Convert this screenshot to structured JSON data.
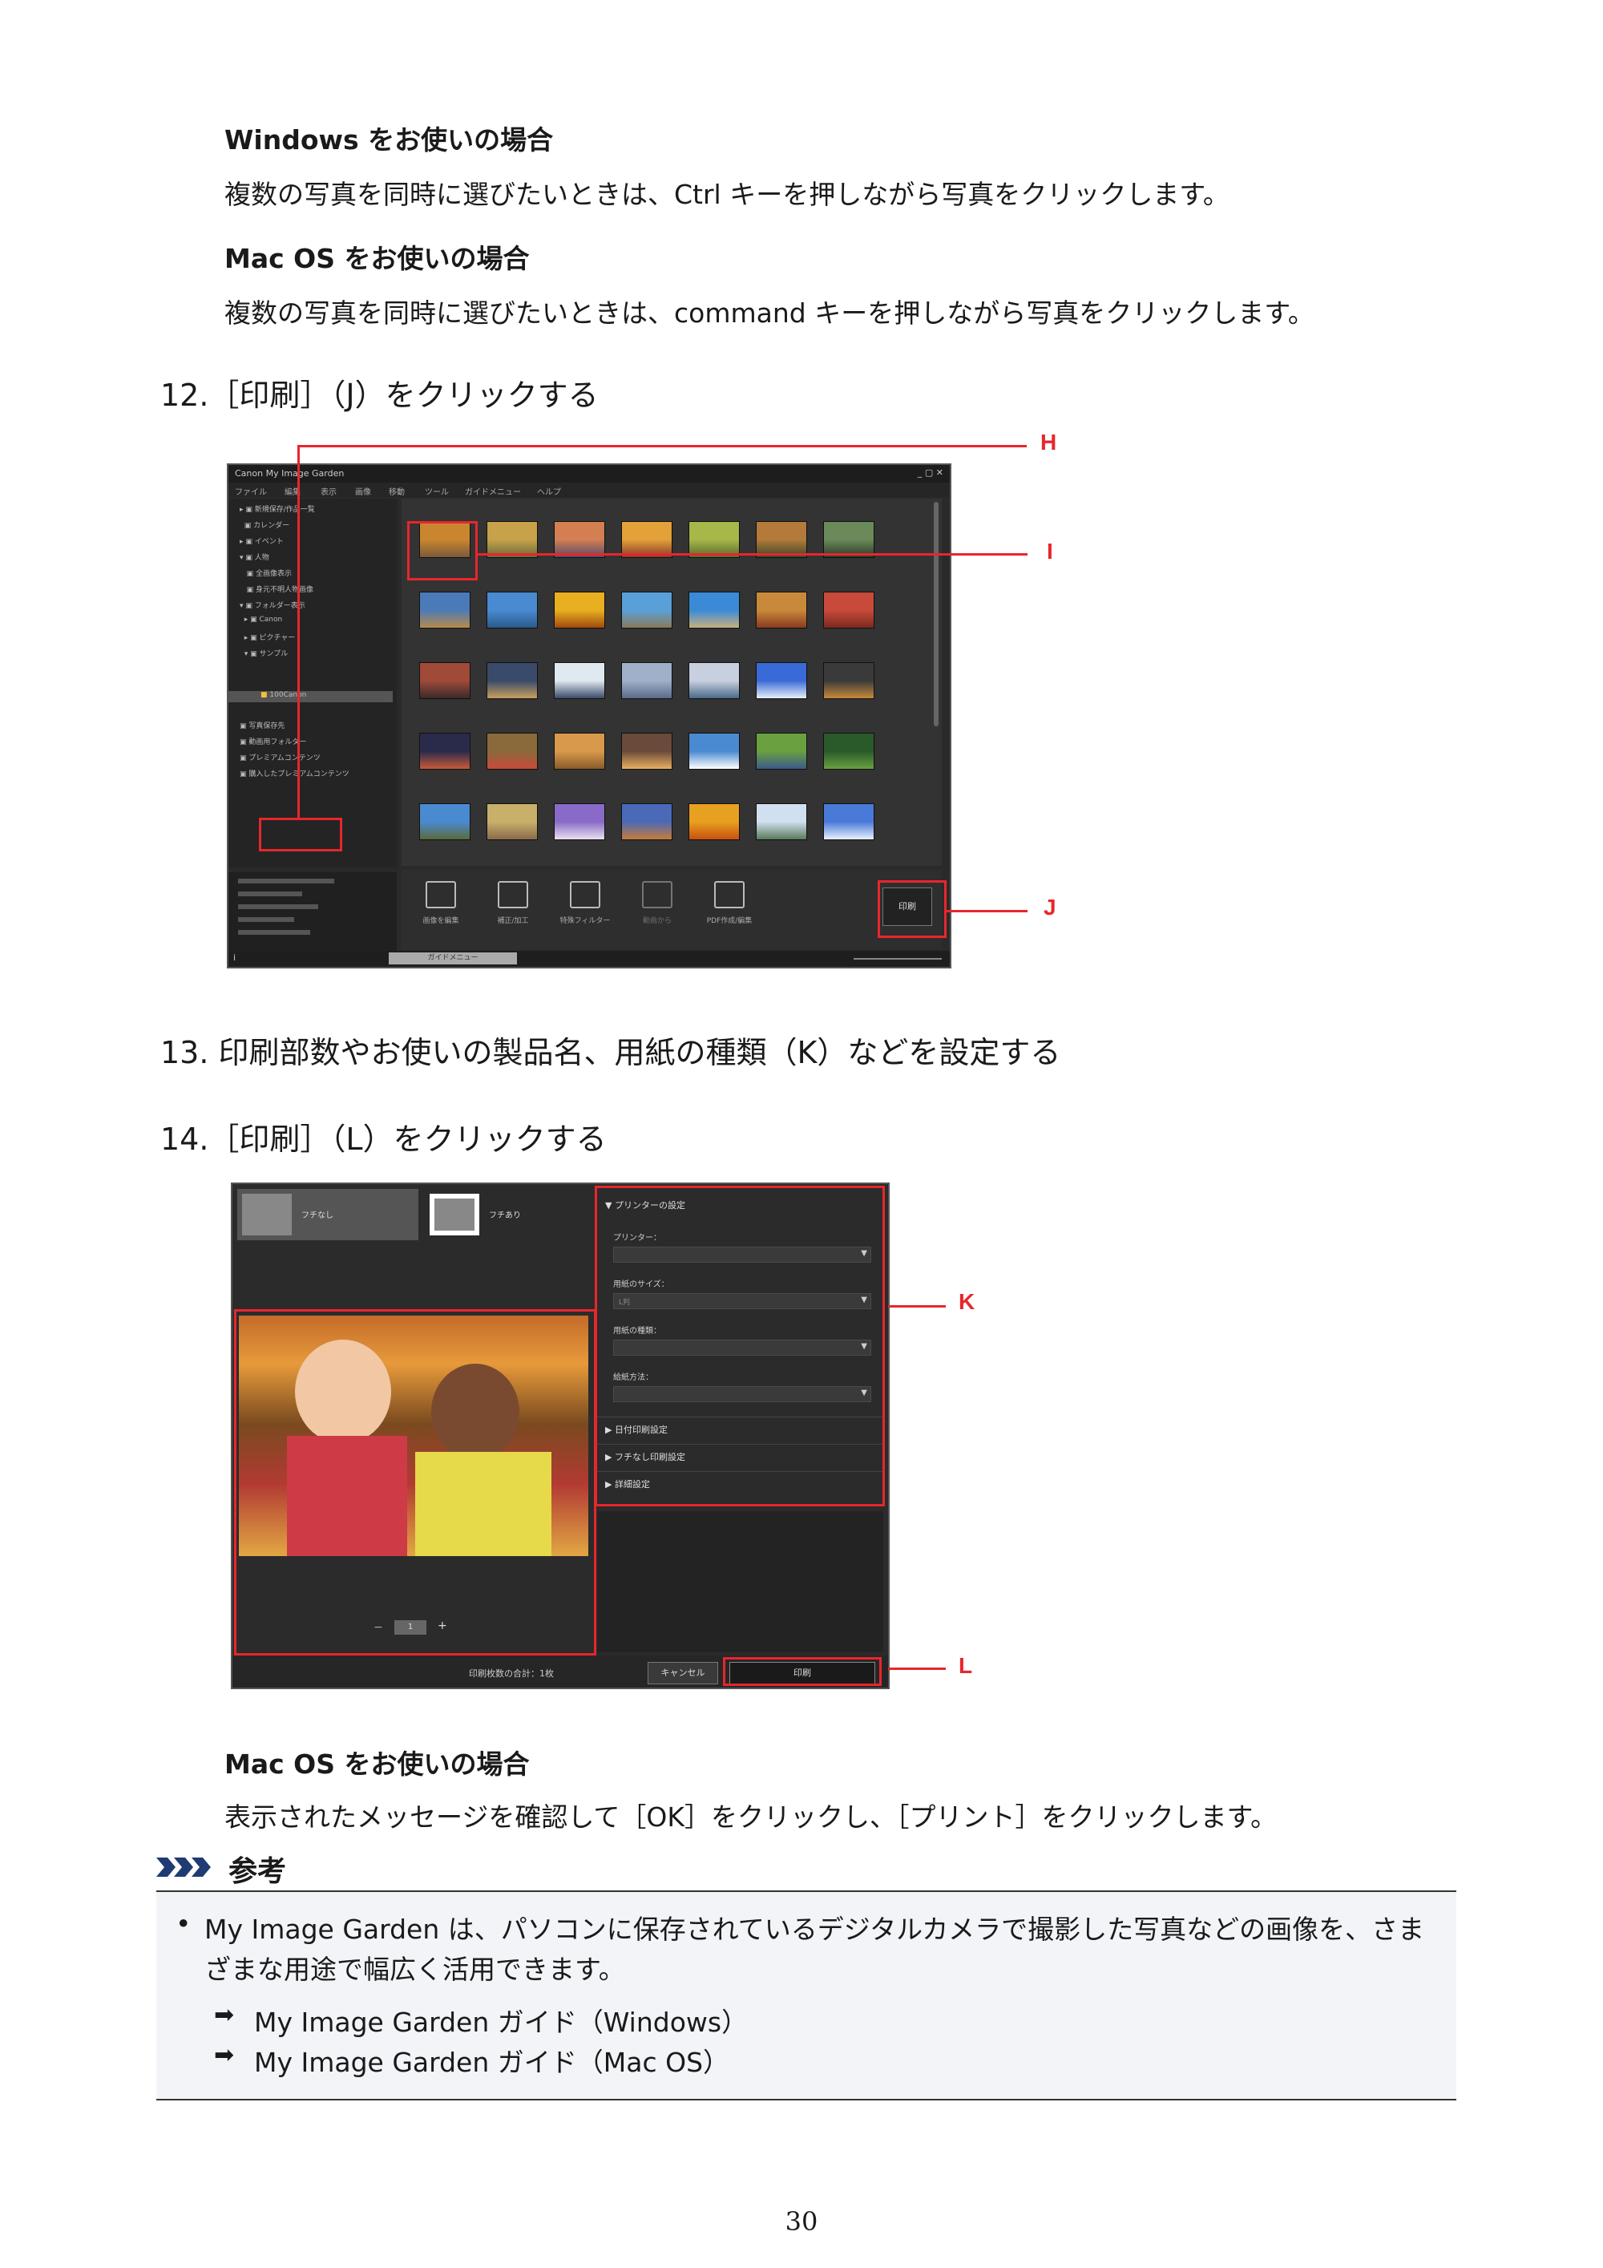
{
  "section1": {
    "windows_heading": "Windows をお使いの場合",
    "windows_text": "複数の写真を同時に選びたいときは、Ctrl キーを押しながら写真をクリックします。",
    "mac_heading": "Mac OS をお使いの場合",
    "mac_text": "複数の写真を同時に選びたいときは、command キーを押しながら写真をクリックします。"
  },
  "step12": "12.［印刷］（J）をクリックする",
  "step13": "13. 印刷部数やお使いの製品名、用紙の種類（K）などを設定する",
  "step14": "14.［印刷］（L）をクリックする",
  "shot1": {
    "title": "Canon My Image Garden",
    "menu": [
      "ファイル",
      "編集",
      "表示",
      "画像",
      "移動",
      "ツール",
      "ガイドメニュー",
      "ヘルプ"
    ],
    "tree": [
      "新規保存/作品一覧",
      "カレンダー",
      "イベント",
      "人物",
      "全画像表示",
      "身元不明人物画像",
      "フォルダー表示",
      "Canon",
      "ピクチャー",
      "サンプル",
      "100Canon",
      "写真保存先",
      "動画用フォルダー",
      "プレミアムコンテンツ",
      "購入したプレミアムコンテンツ"
    ],
    "tools": [
      "画像を編集",
      "補正/加工",
      "特殊フィルター",
      "動画から",
      "PDF作成/編集"
    ],
    "print_button": "印刷",
    "guide_menu_button": "ガイドメニュー",
    "callouts": [
      "H",
      "I",
      "J"
    ]
  },
  "shot2": {
    "layout_borderless": "フチなし",
    "layout_bordered": "フチあり",
    "printer_settings": "プリンターの設定",
    "printer_label": "プリンター：",
    "paper_size_label": "用紙のサイズ：",
    "paper_size_value": "L判",
    "media_type_label": "用紙の種類：",
    "print_method_label": "給紙方法：",
    "date_print": "日付印刷設定",
    "borderless_settings": "フチなし印刷設定",
    "advanced": "詳細設定",
    "page_number": "1",
    "total_prints": "印刷枚数の合計：1枚",
    "cancel": "キャンセル",
    "print": "印刷",
    "callouts": [
      "K",
      "L"
    ]
  },
  "mac_note": {
    "heading": "Mac OS をお使いの場合",
    "text": "表示されたメッセージを確認して［OK］をクリックし、［プリント］をクリックします。"
  },
  "reference": {
    "title": "参考",
    "bullet_line1": "My Image Garden は、パソコンに保存されているデジタルカメラで撮影した写真などの画像を、さま",
    "bullet_line2": "ざまな用途で幅広く活用できます。",
    "link_windows": "My Image Garden ガイド（Windows）",
    "link_mac": "My Image Garden ガイド（Mac OS）"
  },
  "page_number": "30",
  "colors": {
    "callout_red": "#e8262c",
    "note_background": "#f2f4f8",
    "app_dark": "#2a2a2a"
  }
}
